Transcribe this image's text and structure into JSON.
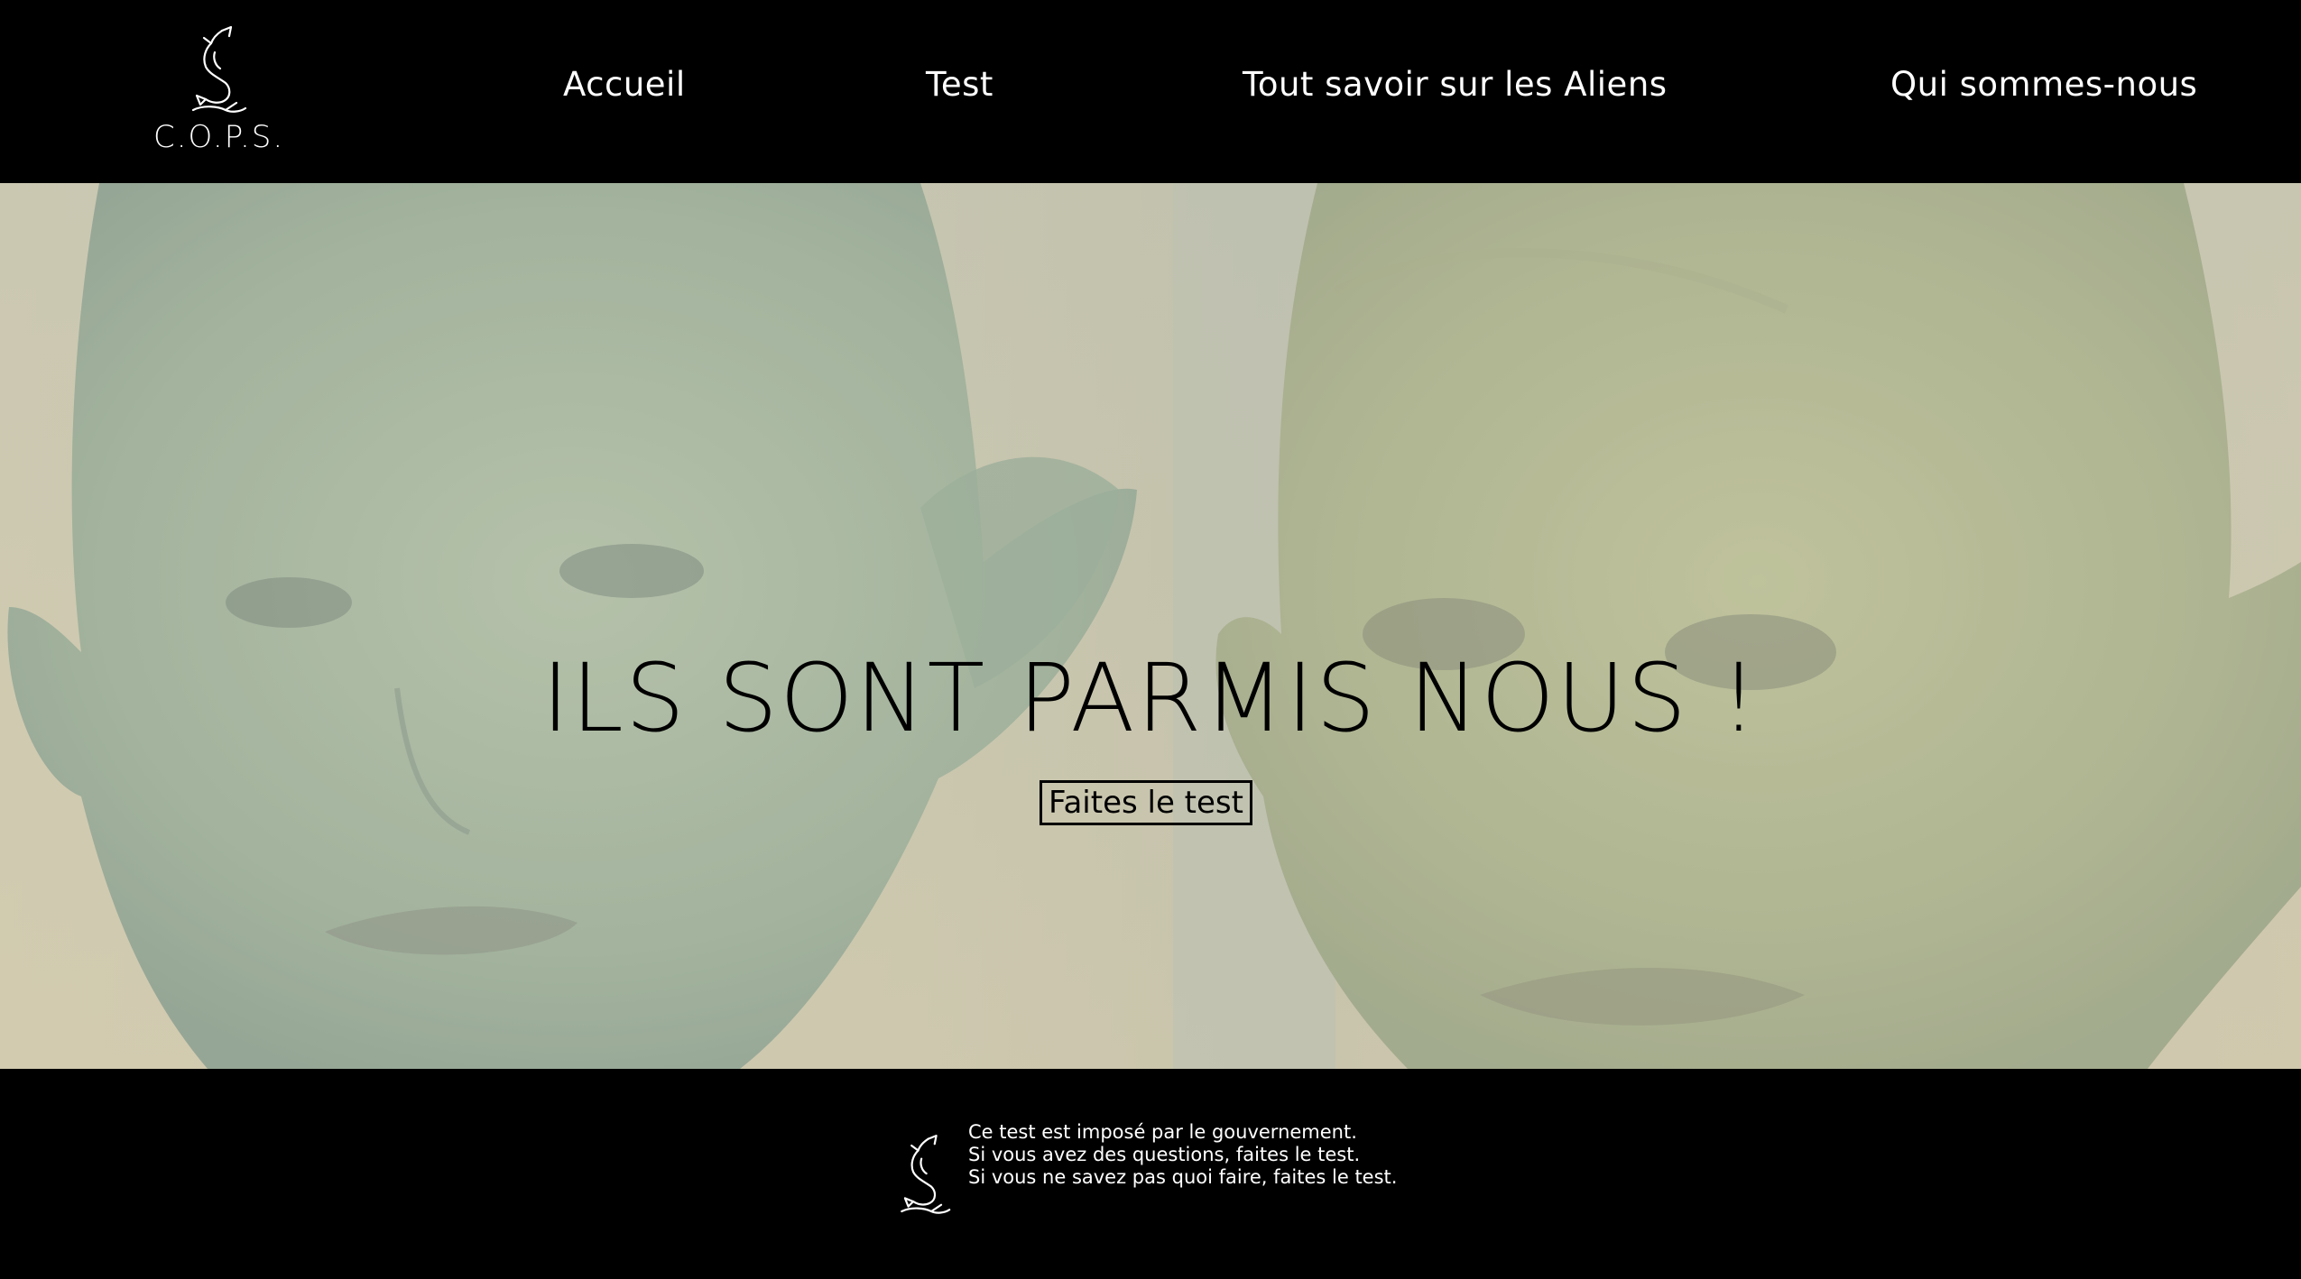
{
  "header": {
    "logo_text": "C.O.P.S.",
    "logo_icon": "dolphin-icon",
    "nav": [
      {
        "label": "Accueil"
      },
      {
        "label": "Test"
      },
      {
        "label": "Tout savoir sur les Aliens"
      },
      {
        "label": "Qui sommes-nous"
      }
    ]
  },
  "hero": {
    "title": "ILS SONT PARMIS NOUS !",
    "cta_label": "Faites le test",
    "background_image": "alien-faces-photo"
  },
  "footer": {
    "logo_icon": "dolphin-icon",
    "lines": [
      "Ce test est imposé par le gouvernement.",
      "Si vous avez des questions, faites le test.",
      "Si vous ne savez pas quoi faire, faites le test."
    ]
  },
  "colors": {
    "header_bg": "#000000",
    "footer_bg": "#000000",
    "text_light": "#ffffff",
    "text_dark": "#000000"
  }
}
